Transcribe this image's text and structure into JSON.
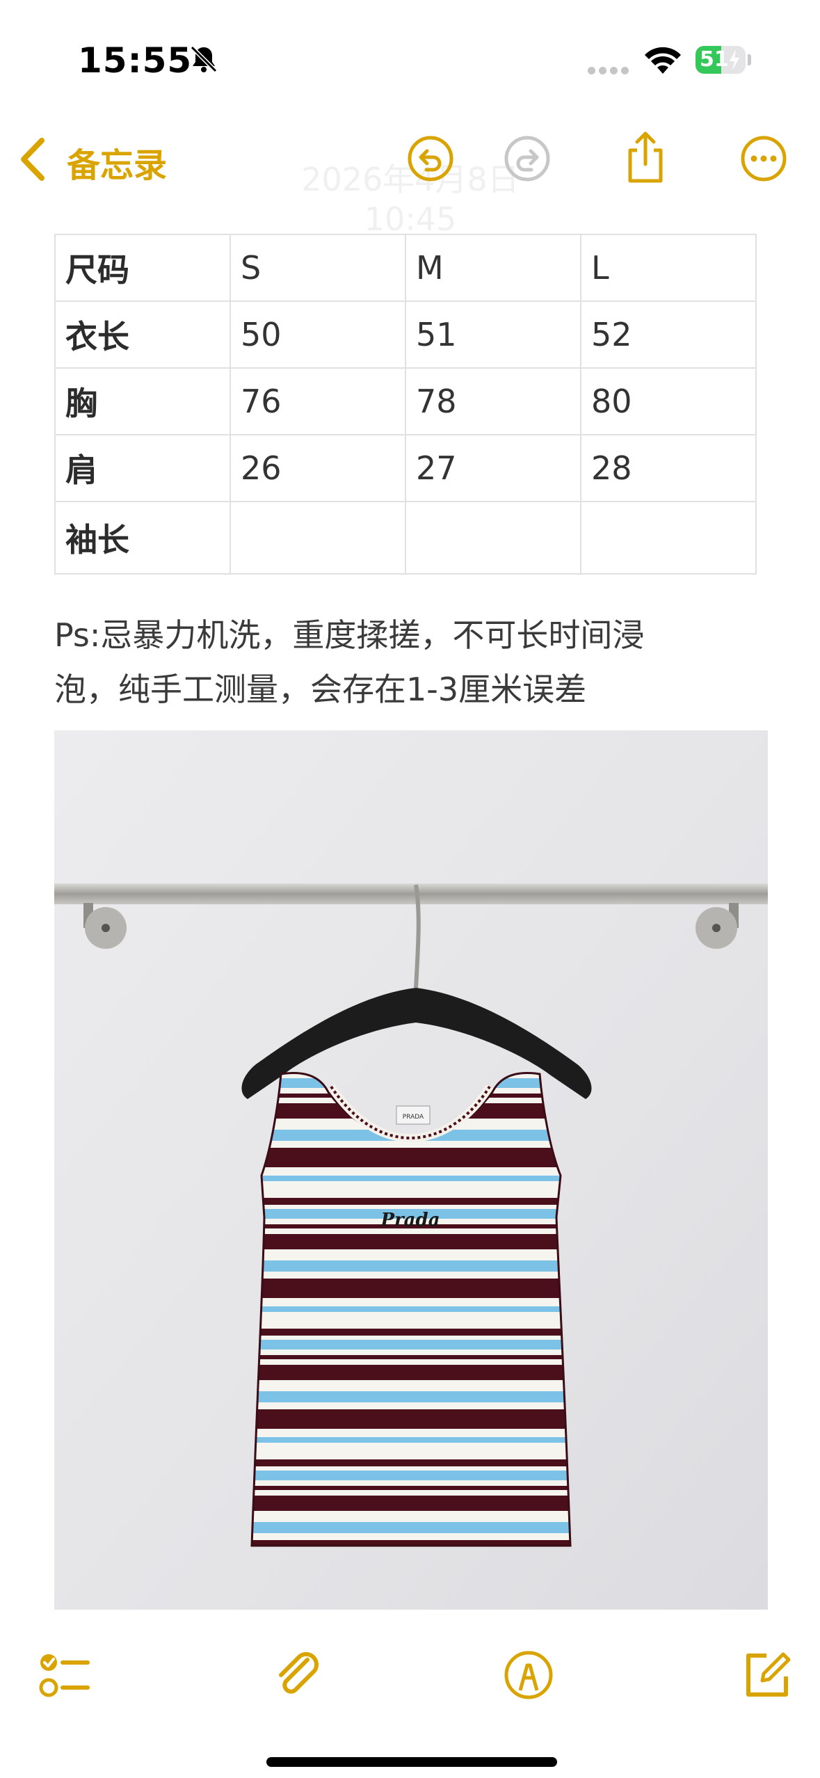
{
  "status_bar": {
    "time": "15:55",
    "battery": "51",
    "battery_level": 0.51
  },
  "nav": {
    "back_label": "备忘录",
    "date": "2026年4月8日 10:45",
    "icons": [
      "undo-icon",
      "redo-icon",
      "share-icon",
      "more-icon"
    ]
  },
  "table": {
    "rows": [
      [
        "尺码",
        "S",
        "M",
        "L"
      ],
      [
        "衣长",
        "50",
        "51",
        "52"
      ],
      [
        "胸",
        "76",
        "78",
        "80"
      ],
      [
        "肩",
        "26",
        "27",
        "28"
      ],
      [
        "袖长",
        "",
        "",
        ""
      ]
    ]
  },
  "note": {
    "line1": "Ps:忌暴力机洗，重度揉搓，不可长时间浸",
    "line2": "泡，纯手工测量，会存在1-3厘米误差"
  },
  "photo": {
    "label_text": "PRADA",
    "logo_text": "Prada"
  },
  "toolbar": {
    "icons": [
      "checklist-icon",
      "attachment-icon",
      "markup-icon",
      "compose-icon"
    ]
  },
  "colors": {
    "accent": "#d9a400",
    "stripe_maroon": "#4a0f1a",
    "stripe_blue": "#7cc2e6",
    "stripe_white": "#f6f4ef"
  }
}
